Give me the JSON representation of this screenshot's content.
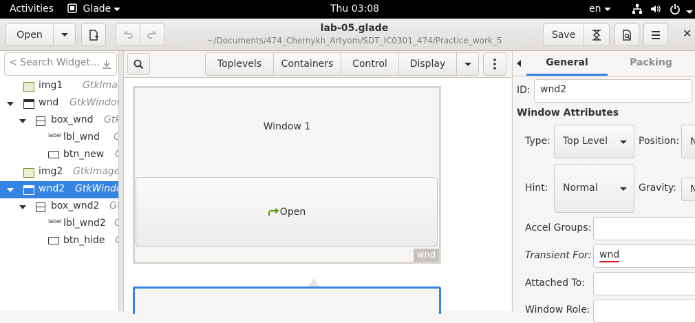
{
  "topbar": {
    "activities": "Activities",
    "app": "Glade",
    "clock": "Thu 03:08",
    "lang": "en"
  },
  "header": {
    "open_label": "Open",
    "title": "lab-05.glade",
    "subtitle": "~/Documents/474_Chernykh_Artyom/SDT_IC0301_474/Practice_work_5",
    "save_label": "Save"
  },
  "left": {
    "search_placeholder": "< Search Widget…",
    "tree": [
      {
        "name": "img1",
        "type": "GtkImage"
      },
      {
        "name": "wnd",
        "type": "GtkWindow"
      },
      {
        "name": "box_wnd",
        "type": "GtkBox"
      },
      {
        "name": "lbl_wnd",
        "type": "GtkLabel"
      },
      {
        "name": "btn_new",
        "type": "GtkButton"
      },
      {
        "name": "img2",
        "type": "GtkImage"
      },
      {
        "name": "wnd2",
        "type": "GtkWindow"
      },
      {
        "name": "box_wnd2",
        "type": "GtkBox"
      },
      {
        "name": "lbl_wnd2",
        "type": "GtkLabel"
      },
      {
        "name": "btn_hide",
        "type": "GtkButton"
      }
    ]
  },
  "center": {
    "tabs": [
      "Toplevels",
      "Containers",
      "Control",
      "Display"
    ],
    "window_label": "Window 1",
    "open_button": "Open",
    "window_tag": "wnd"
  },
  "right": {
    "tabs": [
      "General",
      "Packing"
    ],
    "id_label": "ID:",
    "id_value": "wnd2",
    "section": "Window Attributes",
    "type_label": "Type:",
    "type_value": "Top Level",
    "position_label": "Position:",
    "position_value": "N",
    "hint_label": "Hint:",
    "hint_value": "Normal",
    "gravity_label": "Gravity:",
    "gravity_value": "N",
    "accel_label": "Accel Groups:",
    "transient_label": "Transient For:",
    "transient_value": "wnd",
    "attached_label": "Attached To:",
    "role_label": "Window Role:"
  }
}
